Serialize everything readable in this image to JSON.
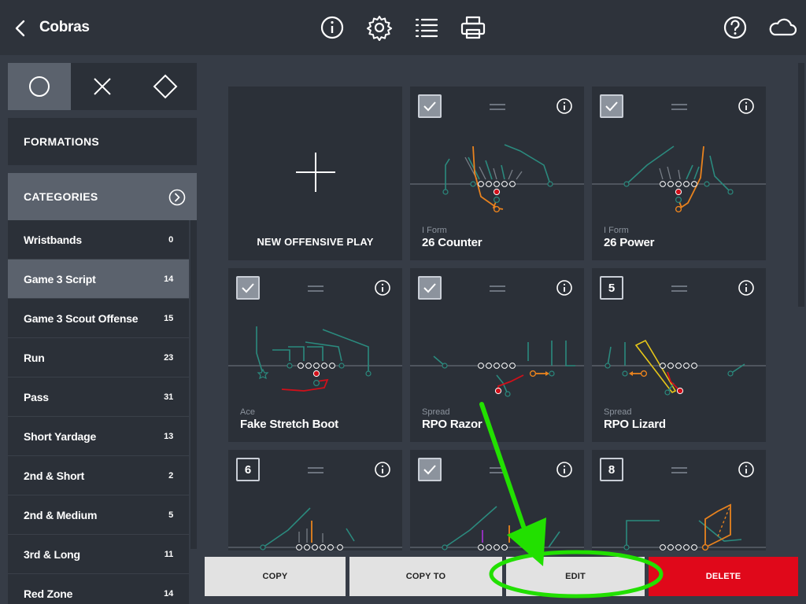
{
  "header": {
    "title": "Cobras",
    "icons": [
      "back-icon",
      "info-icon",
      "gear-icon",
      "list-icon",
      "print-icon",
      "help-icon",
      "cloud-icon"
    ]
  },
  "sidebar": {
    "shape_tabs": [
      "circle-icon",
      "x-icon",
      "diamond-icon"
    ],
    "formations_label": "FORMATIONS",
    "categories_label": "CATEGORIES",
    "items": [
      {
        "label": "Wristbands",
        "count": "0"
      },
      {
        "label": "Game 3 Script",
        "count": "14"
      },
      {
        "label": "Game 3 Scout Offense",
        "count": "15"
      },
      {
        "label": "Run",
        "count": "23"
      },
      {
        "label": "Pass",
        "count": "31"
      },
      {
        "label": "Short Yardage",
        "count": "13"
      },
      {
        "label": "2nd & Short",
        "count": "2"
      },
      {
        "label": "2nd & Medium",
        "count": "5"
      },
      {
        "label": "3rd & Long",
        "count": "11"
      },
      {
        "label": "Red Zone",
        "count": "14"
      }
    ]
  },
  "plays": {
    "new_label": "NEW OFFENSIVE PLAY",
    "cards": [
      {
        "badge": "",
        "checked": true,
        "formation": "I Form",
        "name": "26 Counter"
      },
      {
        "badge": "",
        "checked": true,
        "formation": "I Form",
        "name": "26 Power"
      },
      {
        "badge": "",
        "checked": true,
        "formation": "Ace",
        "name": "Fake Stretch Boot"
      },
      {
        "badge": "",
        "checked": true,
        "formation": "Spread",
        "name": "RPO Razor"
      },
      {
        "badge": "5",
        "checked": false,
        "formation": "Spread",
        "name": "RPO Lizard"
      },
      {
        "badge": "6",
        "checked": false,
        "formation": "",
        "name": ""
      },
      {
        "badge": "",
        "checked": true,
        "formation": "",
        "name": ""
      },
      {
        "badge": "8",
        "checked": false,
        "formation": "",
        "name": ""
      }
    ]
  },
  "actions": {
    "copy": "COPY",
    "copy_to": "COPY TO",
    "edit": "EDIT",
    "delete": "DELETE"
  },
  "colors": {
    "accent_green": "#22e000",
    "delete_red": "#e0081a",
    "route_teal": "#2b8a7e",
    "route_orange": "#e8821e",
    "route_red": "#d0101a",
    "route_yellow": "#e6c619"
  }
}
